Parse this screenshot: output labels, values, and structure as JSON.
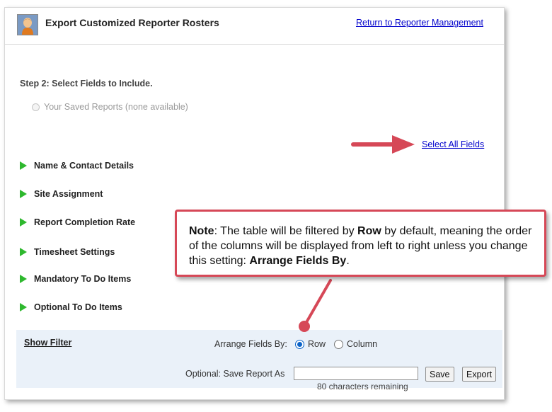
{
  "header": {
    "title": "Export Customized Reporter Rosters",
    "return_link": "Return to Reporter Management"
  },
  "step": {
    "title": "Step 2: Select Fields to Include.",
    "saved_reports": "Your Saved Reports (none available)"
  },
  "select_all": "Select All Fields",
  "sections": [
    "Name & Contact Details",
    "Site Assignment",
    "Report Completion Rate",
    "Timesheet Settings",
    "Mandatory To Do Items",
    "Optional To Do Items"
  ],
  "filter_bar": {
    "show_filter": "Show Filter",
    "arrange_label": "Arrange Fields By:",
    "arrange_options": [
      "Row",
      "Column"
    ],
    "arrange_selected": "Row",
    "save_label": "Optional: Save Report As",
    "save_value": "",
    "save_button": "Save",
    "export_button": "Export",
    "remaining": "80 characters remaining"
  },
  "note": {
    "lead": "Note",
    "text1": ": The table will be filtered by ",
    "row_word": "Row",
    "text2": " by default, meaning the order of the columns will be displayed from left to right unless you change this setting: ",
    "setting": "Arrange Fields By",
    "end": "."
  },
  "colors": {
    "link": "#0000cc",
    "triangle": "#2eb82e",
    "callout": "#d64857",
    "filter_bg": "#eaf1f9",
    "radio_selected": "#0b63c8"
  }
}
